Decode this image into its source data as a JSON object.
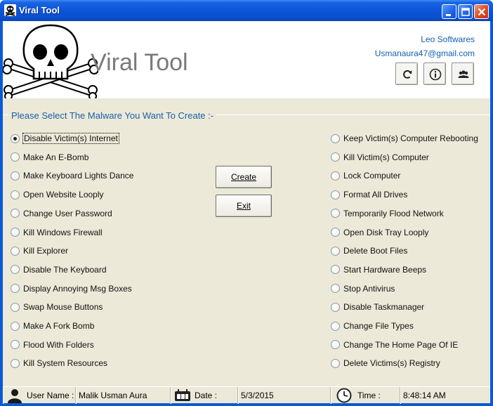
{
  "window": {
    "title": "Viral Tool",
    "icon": "skull-icon",
    "controls": [
      "minimize-icon",
      "maximize-icon",
      "close-icon"
    ]
  },
  "header": {
    "app_title": "Viral Tool",
    "company": "Leo Softwares",
    "email": "Usmanaura47@gmail.com",
    "buttons": [
      "refresh-icon",
      "info-icon",
      "users-icon"
    ]
  },
  "group": {
    "label": "Please Select The Malware You Want To Create :-"
  },
  "options_left": [
    {
      "label": "Disable Victim(s) Internet",
      "checked": true
    },
    {
      "label": "Make An E-Bomb",
      "checked": false
    },
    {
      "label": "Make Keyboard Lights Dance",
      "checked": false
    },
    {
      "label": "Open Website Looply",
      "checked": false
    },
    {
      "label": "Change User Password",
      "checked": false
    },
    {
      "label": "Kill Windows Firewall",
      "checked": false
    },
    {
      "label": "Kill Explorer",
      "checked": false
    },
    {
      "label": "Disable The Keyboard",
      "checked": false
    },
    {
      "label": "Display Annoying Msg Boxes",
      "checked": false
    },
    {
      "label": "Swap Mouse Buttons",
      "checked": false
    },
    {
      "label": "Make A Fork Bomb",
      "checked": false
    },
    {
      "label": "Flood With Folders",
      "checked": false
    },
    {
      "label": "Kill System Resources",
      "checked": false
    }
  ],
  "options_right": [
    {
      "label": "Keep Victim(s) Computer Rebooting",
      "checked": false
    },
    {
      "label": "Kill Victim(s) Computer",
      "checked": false
    },
    {
      "label": "Lock Computer",
      "checked": false
    },
    {
      "label": "Format All Drives",
      "checked": false
    },
    {
      "label": "Temporarily Flood Network",
      "checked": false
    },
    {
      "label": "Open Disk Tray Looply",
      "checked": false
    },
    {
      "label": "Delete Boot Files",
      "checked": false
    },
    {
      "label": "Start Hardware Beeps",
      "checked": false
    },
    {
      "label": "Stop Antivirus",
      "checked": false
    },
    {
      "label": "Disable Taskmanager",
      "checked": false
    },
    {
      "label": "Change File Types",
      "checked": false
    },
    {
      "label": "Change The Home Page Of IE",
      "checked": false
    },
    {
      "label": "Delete Victims(s) Registry",
      "checked": false
    }
  ],
  "actions": {
    "create_label": "Create",
    "exit_label": "Exit"
  },
  "status": {
    "user_label": "User Name :",
    "user_value": "Malik Usman Aura",
    "date_label": "Date :",
    "date_value": "5/3/2015",
    "time_label": "Time :",
    "time_value": "8:48:14 AM",
    "icons": [
      "user-icon",
      "calendar-icon",
      "clock-icon"
    ]
  }
}
